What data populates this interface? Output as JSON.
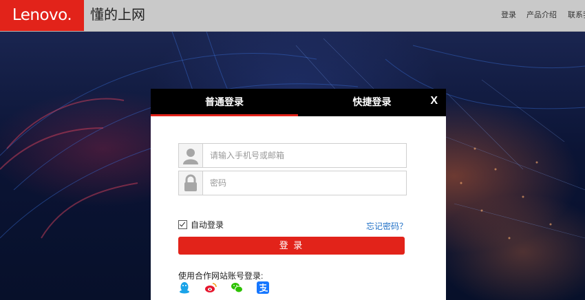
{
  "header": {
    "logo": "Lenovo.",
    "tagline": "懂的上网",
    "nav": [
      "登录",
      "产品介绍",
      "联系我"
    ]
  },
  "login_modal": {
    "tabs": [
      {
        "label": "普通登录",
        "active": true
      },
      {
        "label": "快捷登录",
        "active": false
      }
    ],
    "close_label": "X",
    "account_input": {
      "placeholder": "请输入手机号或邮箱",
      "value": ""
    },
    "password_input": {
      "placeholder": "密码",
      "value": ""
    },
    "remember_label": "自动登录",
    "remember_checked": true,
    "forgot_label": "忘记密码？",
    "submit_label": "登 录",
    "social_label": "使用合作网站账号登录:",
    "social_icons": [
      "qq-icon",
      "weibo-icon",
      "wechat-icon",
      "alipay-icon"
    ]
  },
  "colors": {
    "brand_red": "#e2231a",
    "link_blue": "#1e6fc6",
    "tab_bar": "#000000"
  }
}
